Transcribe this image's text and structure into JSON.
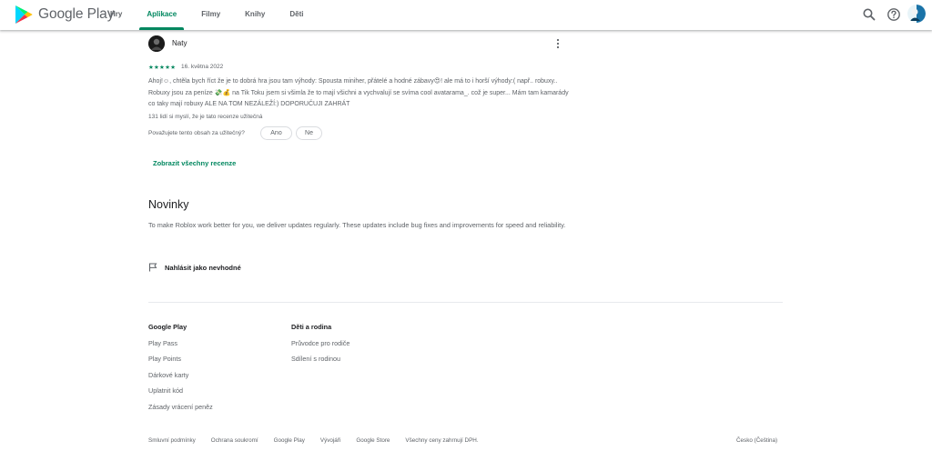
{
  "header": {
    "brand": "Google Play",
    "tabs": [
      {
        "label": "Hry",
        "active": false
      },
      {
        "label": "Aplikace",
        "active": true
      },
      {
        "label": "Filmy",
        "active": false
      },
      {
        "label": "Knihy",
        "active": false
      },
      {
        "label": "Děti",
        "active": false
      }
    ],
    "icons": [
      "search-icon",
      "help-icon",
      "account-avatar"
    ]
  },
  "review": {
    "author": "Naty",
    "stars": "★★★★★",
    "rating": 5,
    "date": "16. května 2022",
    "text": "Ahoj!☺, chtěla bych říct že je to dobrá hra jsou tam výhody: Spousta miniher, přátelé a hodné zábavy😍! ale má to i horší výhody:( např.. robuxy.. Robuxy jsou za peníze 💸💰 na Tik Toku jsem si všimla že to mají všichni a vychvalují se svíma cool avatarama_. což je super... Mám tam kamarády co taky mají robuxy ALE NA TOM NEZÁLEŽÍ:) DOPORUČUJI ZAHRÁT",
    "helpful_count": "131 lidí si myslí, že je tato recenze užitečná",
    "question": "Považujete tento obsah za užitečný?",
    "yes_label": "Ano",
    "no_label": "Ne"
  },
  "see_all_reviews": "Zobrazit všechny recenze",
  "news": {
    "title": "Novinky",
    "text": "To make Roblox work better for you, we deliver updates regularly. These updates include bug fixes and improvements for speed and reliability."
  },
  "report": "Nahlásit jako nevhodné",
  "footer": {
    "col1": {
      "heading": "Google Play",
      "links": [
        "Play Pass",
        "Play Points",
        "Dárkové karty",
        "Uplatnit kód",
        "Zásady vrácení peněz"
      ]
    },
    "col2": {
      "heading": "Děti a rodina",
      "links": [
        "Průvodce pro rodiče",
        "Sdílení s rodinou"
      ]
    },
    "legal": [
      "Smluvní podmínky",
      "Ochrana soukromí",
      "Google Play",
      "Vývojáři",
      "Google Store",
      "Všechny ceny zahrnují DPH."
    ],
    "locale": "Česko (Čeština)"
  },
  "colors": {
    "accent": "#01875f",
    "text": "#202124",
    "secondary": "#5f6368"
  }
}
